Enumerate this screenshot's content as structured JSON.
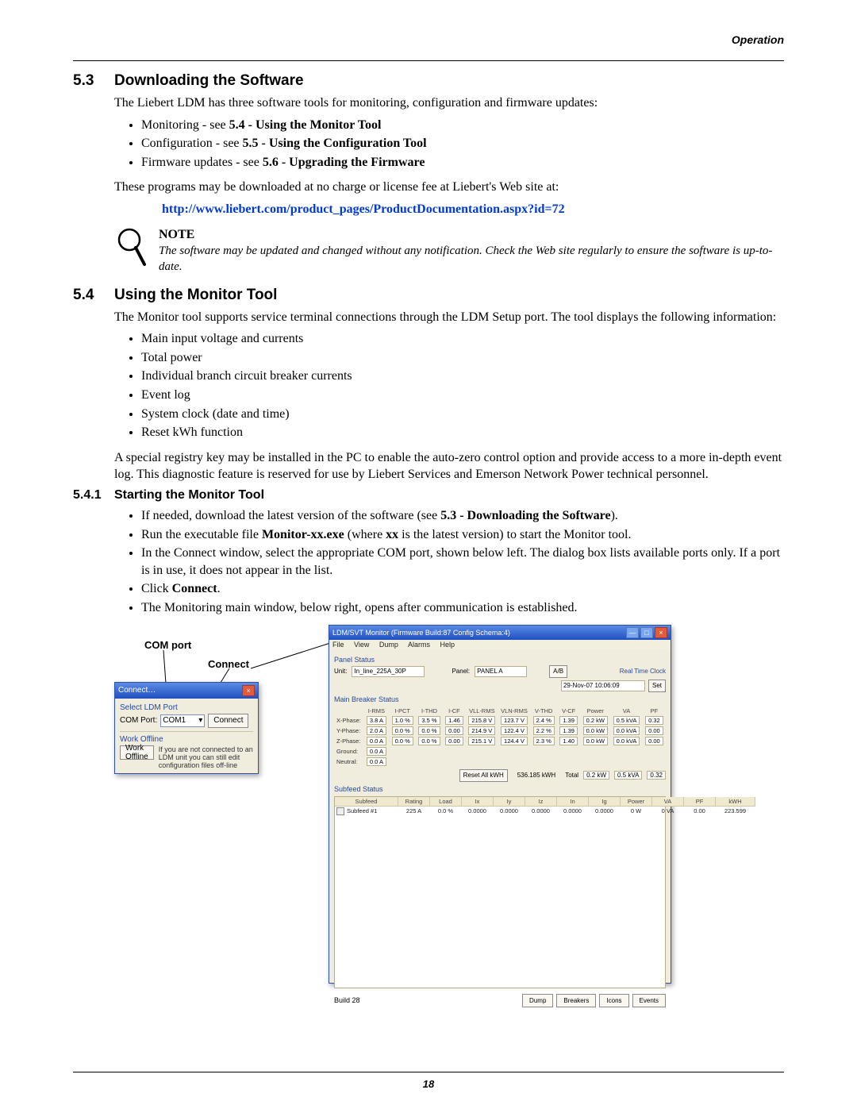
{
  "header": {
    "running": "Operation"
  },
  "s53": {
    "num": "5.3",
    "title": "Downloading the Software",
    "intro": "The Liebert LDM has three software tools for monitoring, configuration and firmware updates:",
    "bullets": [
      {
        "pre": "Monitoring - see ",
        "bold": "5.4 - Using the Monitor Tool"
      },
      {
        "pre": "Configuration - see ",
        "bold": "5.5 - Using the Configuration Tool"
      },
      {
        "pre": "Firmware updates - see ",
        "bold": "5.6 - Upgrading the Firmware"
      }
    ],
    "p2": "These programs may be downloaded at no charge or license fee at Liebert's Web site at:",
    "link": "http://www.liebert.com/product_pages/ProductDocumentation.aspx?id=72",
    "note_head": "NOTE",
    "note_body": "The software may be updated and changed without any notification. Check the Web site regularly to ensure the software is up-to-date."
  },
  "s54": {
    "num": "5.4",
    "title": "Using the Monitor Tool",
    "intro": "The Monitor tool supports service terminal connections through the LDM Setup port. The tool displays the following information:",
    "info_list": [
      "Main input voltage and currents",
      "Total power",
      "Individual branch circuit breaker currents",
      "Event log",
      "System clock (date and time)",
      "Reset kWh function"
    ],
    "para2": "A special registry key may be installed in the PC to enable the auto-zero control option and provide access to a more in-depth event log. This diagnostic feature is reserved for use by Liebert Services and Emerson Network Power technical personnel."
  },
  "s541": {
    "num": "5.4.1",
    "title": "Starting the Monitor Tool",
    "bullets": [
      {
        "type": "composite",
        "parts": [
          "If needed, download the latest version of the software (see ",
          {
            "b": "5.3 - Downloading the Software"
          },
          ")."
        ]
      },
      {
        "type": "composite",
        "parts": [
          "Run the executable file ",
          {
            "b": "Monitor-xx.exe"
          },
          " (where ",
          {
            "b": "xx"
          },
          " is the latest version) to start the Monitor tool."
        ]
      },
      {
        "type": "plain",
        "text": "In the Connect window, select the appropriate COM port, shown below left. The dialog box lists available ports only. If a port is in use, it does not appear in the list."
      },
      {
        "type": "composite",
        "parts": [
          "Click ",
          {
            "b": "Connect"
          },
          "."
        ]
      },
      {
        "type": "plain",
        "text": "The Monitoring main window, below right, opens after communication is established."
      }
    ]
  },
  "labels": {
    "com_port": "COM port",
    "connect": "Connect"
  },
  "dlg_connect": {
    "title": "Connect…",
    "select_label": "Select LDM Port",
    "com_port_label": "COM Port:",
    "com_value": "COM1",
    "connect_btn": "Connect",
    "work_offline_label": "Work Offline",
    "work_offline_btn": "Work Offline",
    "work_offline_text": "If you are not connected to an LDM unit you can still edit configuration files off-line"
  },
  "dlg_monitor": {
    "title": "LDM/SVT Monitor (Firmware Build:87 Config Schema:4)",
    "menu": [
      "File",
      "View",
      "Dump",
      "Alarms",
      "Help"
    ],
    "panel_status_label": "Panel Status",
    "unit_label": "Unit:",
    "unit_value": "In_line_225A_30P",
    "panel_label": "Panel:",
    "panel_value": "PANEL A",
    "ab_btn": "A/B",
    "rtc_label": "Real Time Clock",
    "rtc_value": "29-Nov-07 10:06:09",
    "set_btn": "Set",
    "main_breaker_label": "Main Breaker Status",
    "mb_headers": [
      "",
      "I-RMS",
      "I-PCT",
      "I-THD",
      "I-CF",
      "VLL-RMS",
      "VLN-RMS",
      "V-THD",
      "V-CF",
      "Power",
      "VA",
      "PF"
    ],
    "mb_rows": [
      {
        "label": "X-Phase:",
        "vals": [
          "3.8 A",
          "1.0 %",
          "3.5 %",
          "1.46",
          "215.8 V",
          "123.7 V",
          "2.4 %",
          "1.39",
          "0.2 kW",
          "0.5 kVA",
          "0.32"
        ]
      },
      {
        "label": "Y-Phase:",
        "vals": [
          "2.0 A",
          "0.0 %",
          "0.0 %",
          "0.00",
          "214.9 V",
          "122.4 V",
          "2.2 %",
          "1.39",
          "0.0 kW",
          "0.0 kVA",
          "0.00"
        ]
      },
      {
        "label": "Z-Phase:",
        "vals": [
          "0.0 A",
          "0.0 %",
          "0.0 %",
          "0.00",
          "215.1 V",
          "124.4 V",
          "2.3 %",
          "1.40",
          "0.0 kW",
          "0.0 kVA",
          "0.00"
        ]
      },
      {
        "label": "Ground:",
        "vals": [
          "0.0 A",
          "",
          "",
          "",
          "",
          "",
          "",
          "",
          "",
          "",
          ""
        ]
      },
      {
        "label": "Neutral:",
        "vals": [
          "0.0 A",
          "",
          "",
          "",
          "",
          "",
          "",
          "",
          "",
          "",
          ""
        ]
      }
    ],
    "reset_kwh_btn": "Reset All kWH",
    "kwh_value": "536.185 kWH",
    "total_label": "Total",
    "total_vals": [
      "0.2 kW",
      "0.5 kVA",
      "0.32"
    ],
    "subfeed_label": "Subfeed Status",
    "sf_headers": [
      "Subfeed",
      "Rating",
      "Load",
      "Ix",
      "Iy",
      "Iz",
      "In",
      "Ig",
      "Power",
      "VA",
      "PF",
      "kWH"
    ],
    "sf_row": {
      "name": "Subfeed #1",
      "vals": [
        "225 A",
        "0.0 %",
        "0.0000",
        "0.0000",
        "0.0000",
        "0.0000",
        "0.0000",
        "0 W",
        "0 VA",
        "0.00",
        "223.599"
      ]
    },
    "build": "Build 28",
    "footer_btns": [
      "Dump",
      "Breakers",
      "Icons",
      "Events"
    ]
  },
  "page_number": "18"
}
